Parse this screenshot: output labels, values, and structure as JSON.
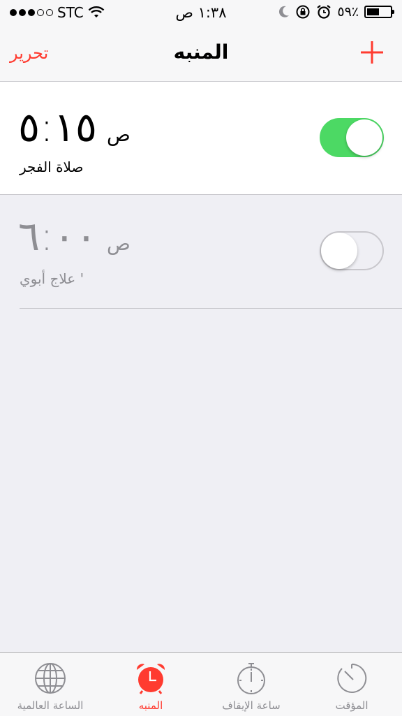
{
  "status_bar": {
    "carrier": "STC",
    "time": "١:٣٨ ص",
    "battery": "٥٩٪",
    "battery_level": 0.59,
    "signal_bars_filled": 3,
    "signal_bars_total": 5
  },
  "nav": {
    "edit_label": "تحرير",
    "title": "المنبه",
    "add_icon": "plus-icon"
  },
  "alarms": [
    {
      "time": "٥:١٥",
      "ampm": "ص",
      "label": "صلاة الفجر",
      "enabled": true
    },
    {
      "time": "٦:٠٠",
      "ampm": "ص",
      "label": "علاج أبوي '",
      "enabled": false
    }
  ],
  "tabs": [
    {
      "label": "الساعة العالمية",
      "icon": "globe-icon",
      "active": false
    },
    {
      "label": "المنبه",
      "icon": "alarm-clock-icon",
      "active": true
    },
    {
      "label": "ساعة الإيقاف",
      "icon": "stopwatch-icon",
      "active": false
    },
    {
      "label": "المؤقت",
      "icon": "timer-icon",
      "active": false
    }
  ],
  "colors": {
    "accent": "#ff3b30",
    "toggle_on": "#4cd964",
    "inactive": "#8e8e93",
    "background": "#efeff4"
  }
}
